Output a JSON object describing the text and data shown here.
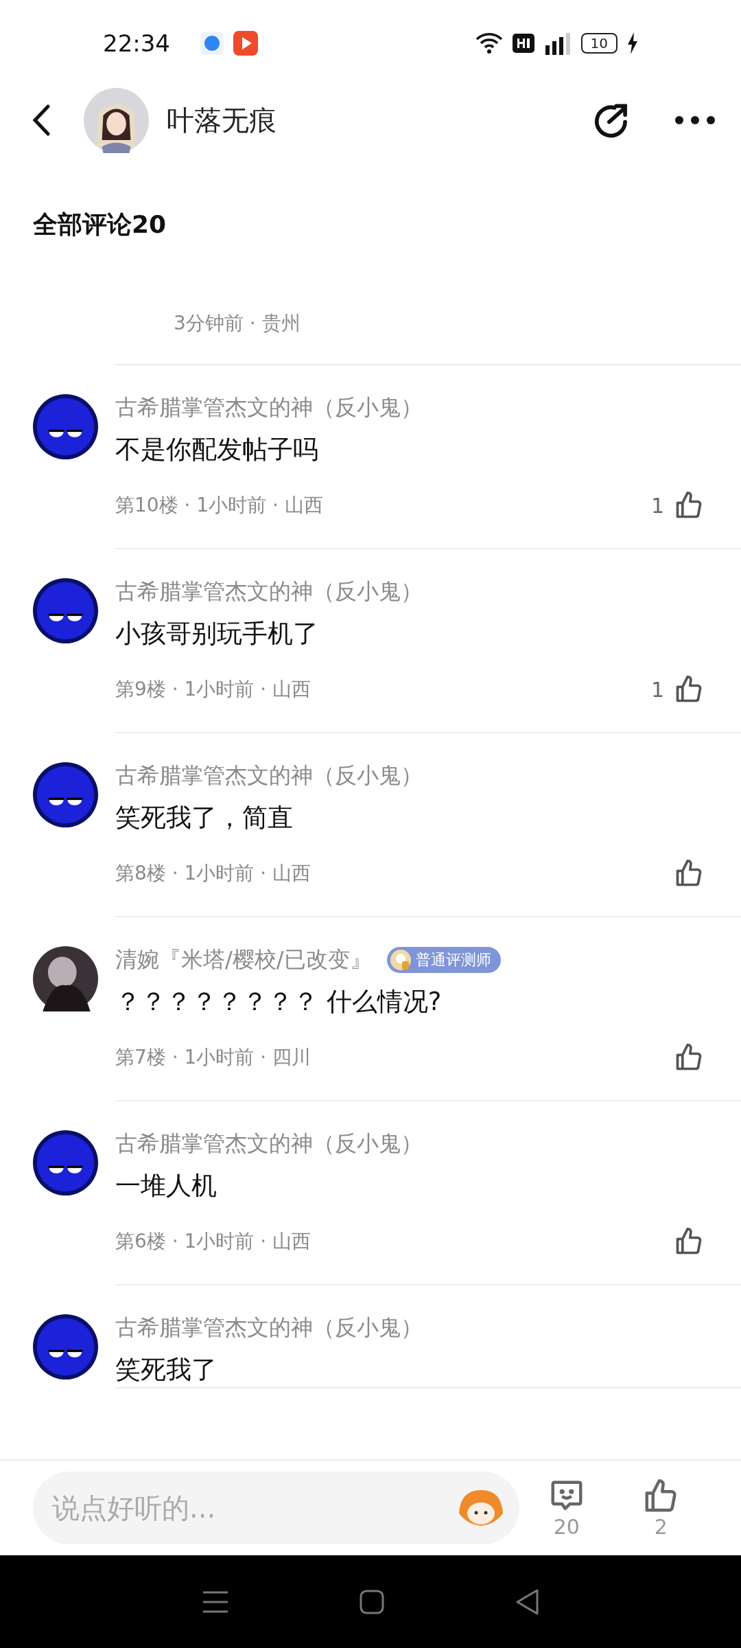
{
  "status_bar": {
    "time": "22:34",
    "battery": "10"
  },
  "header": {
    "username": "叶落无痕"
  },
  "comments_title": "全部评论20",
  "comments": [
    {
      "kind": "partial",
      "meta": "3分钟前 · 贵州"
    },
    {
      "kind": "full",
      "avatar": {
        "kind": "mascot"
      },
      "name": "古希腊掌管杰文的神（反小鬼）",
      "text": "不是你配发帖子吗",
      "meta": "第10楼 · 1小时前 · 山西",
      "likes": "1"
    },
    {
      "kind": "full",
      "avatar": {
        "kind": "mascot"
      },
      "name": "古希腊掌管杰文的神（反小鬼）",
      "text": "小孩哥别玩手机了",
      "meta": "第9楼 · 1小时前 · 山西",
      "likes": "1"
    },
    {
      "kind": "full",
      "avatar": {
        "kind": "mascot"
      },
      "name": "古希腊掌管杰文的神（反小鬼）",
      "text": "笑死我了，简直",
      "meta": "第8楼 · 1小时前 · 山西"
    },
    {
      "kind": "full",
      "avatar": {
        "kind": "portrait"
      },
      "name": "清婉『米塔/樱校/已改变』",
      "badge": "普通评测师",
      "text": "？？？？？？？？ 什么情况?",
      "meta": "第7楼 · 1小时前 · 四川"
    },
    {
      "kind": "full",
      "avatar": {
        "kind": "mascot"
      },
      "name": "古希腊掌管杰文的神（反小鬼）",
      "text": "一堆人机",
      "meta": "第6楼 · 1小时前 · 山西"
    },
    {
      "kind": "full",
      "avatar": {
        "kind": "mascot"
      },
      "name": "古希腊掌管杰文的神（反小鬼）",
      "text": "笑死我了"
    }
  ],
  "input": {
    "placeholder": "说点好听的..."
  },
  "actions": [
    {
      "kind": "comment",
      "count": "20"
    },
    {
      "kind": "like",
      "count": "2"
    }
  ]
}
